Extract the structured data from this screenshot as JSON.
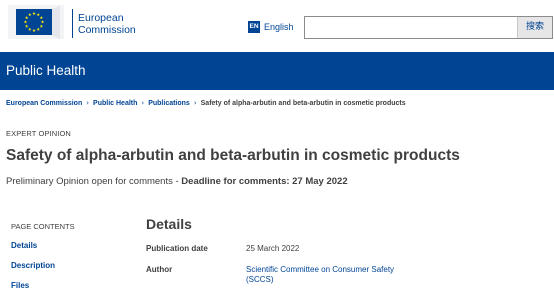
{
  "header": {
    "logo": {
      "line1": "European",
      "line2": "Commission"
    },
    "language": {
      "code": "EN",
      "label": "English"
    },
    "search": {
      "value": "",
      "placeholder": "",
      "button_label": "搜索"
    }
  },
  "site": {
    "title": "Public Health"
  },
  "breadcrumb": {
    "items": [
      "European Commission",
      "Public Health",
      "Publications"
    ],
    "current": "Safety of alpha-arbutin and beta-arbutin in cosmetic products"
  },
  "page": {
    "type": "EXPERT OPINION",
    "title": "Safety of alpha-arbutin and beta-arbutin in cosmetic products",
    "subtitle_prefix": "Preliminary Opinion open for comments - ",
    "subtitle_deadline": "Deadline for comments: 27 May 2022"
  },
  "page_contents": {
    "heading": "PAGE CONTENTS",
    "items": [
      "Details",
      "Description",
      "Files"
    ]
  },
  "details": {
    "heading": "Details",
    "fields": [
      {
        "label": "Publication date",
        "value": "25 March 2022"
      },
      {
        "label": "Author",
        "value_line1": "Scientific Committee on Consumer Safety",
        "value_line2": "(SCCS)"
      }
    ]
  },
  "colors": {
    "brand_blue": "#004494",
    "flag_yellow": "#ffed00",
    "text": "#404040"
  },
  "icons": [
    "eu-flag-icon",
    "language-icon",
    "chevron-right-icon"
  ]
}
